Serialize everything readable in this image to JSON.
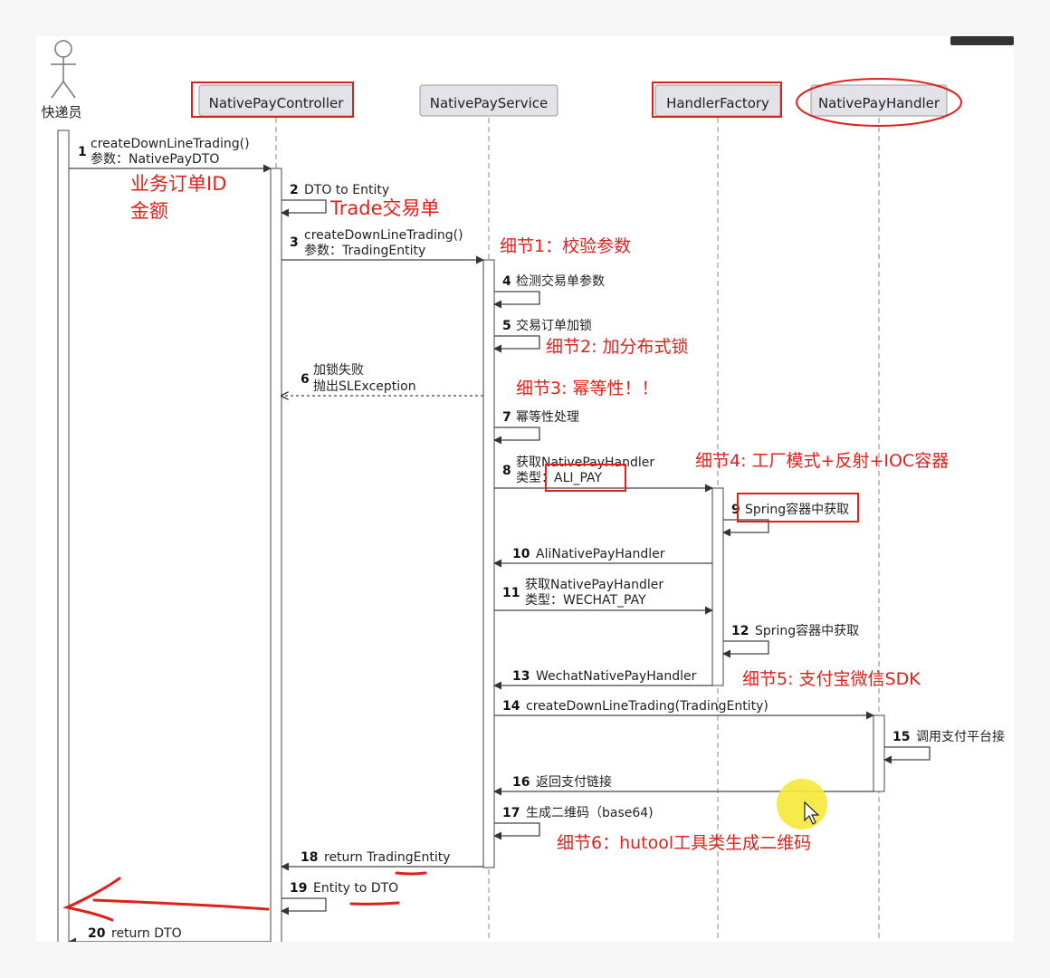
{
  "actor": {
    "label": "快递员"
  },
  "participants": [
    {
      "id": "ctrl",
      "label": "NativePayController",
      "highlight": "box"
    },
    {
      "id": "svc",
      "label": "NativePayService",
      "highlight": "none"
    },
    {
      "id": "fac",
      "label": "HandlerFactory",
      "highlight": "box"
    },
    {
      "id": "hdl",
      "label": "NativePayHandler",
      "highlight": "ellipse"
    }
  ],
  "messages": [
    {
      "n": "1",
      "lines": [
        "createDownLineTrading()",
        "参数：NativePayDTO"
      ],
      "from": "actor",
      "to": "ctrl",
      "kind": "sync"
    },
    {
      "n": "2",
      "lines": [
        "DTO to Entity"
      ],
      "from": "ctrl",
      "to": "ctrl",
      "kind": "self"
    },
    {
      "n": "3",
      "lines": [
        "createDownLineTrading()",
        "参数：TradingEntity"
      ],
      "from": "ctrl",
      "to": "svc",
      "kind": "sync"
    },
    {
      "n": "4",
      "lines": [
        "检测交易单参数"
      ],
      "from": "svc",
      "to": "svc",
      "kind": "self"
    },
    {
      "n": "5",
      "lines": [
        "交易订单加锁"
      ],
      "from": "svc",
      "to": "svc",
      "kind": "self"
    },
    {
      "n": "6",
      "lines": [
        "加锁失败",
        "抛出SLException"
      ],
      "from": "svc",
      "to": "ctrl",
      "kind": "return"
    },
    {
      "n": "7",
      "lines": [
        "幂等性处理"
      ],
      "from": "svc",
      "to": "svc",
      "kind": "self"
    },
    {
      "n": "8",
      "lines": [
        "获取NativePayHandler",
        "类型：ALI_PAY"
      ],
      "from": "svc",
      "to": "fac",
      "kind": "sync"
    },
    {
      "n": "9",
      "lines": [
        "Spring容器中获取"
      ],
      "from": "fac",
      "to": "fac",
      "kind": "self"
    },
    {
      "n": "10",
      "lines": [
        "AliNativePayHandler"
      ],
      "from": "fac",
      "to": "svc",
      "kind": "sync"
    },
    {
      "n": "11",
      "lines": [
        "获取NativePayHandler",
        "类型：WECHAT_PAY"
      ],
      "from": "svc",
      "to": "fac",
      "kind": "sync"
    },
    {
      "n": "12",
      "lines": [
        "Spring容器中获取"
      ],
      "from": "fac",
      "to": "fac",
      "kind": "self"
    },
    {
      "n": "13",
      "lines": [
        "WechatNativePayHandler"
      ],
      "from": "fac",
      "to": "svc",
      "kind": "sync"
    },
    {
      "n": "14",
      "lines": [
        "createDownLineTrading(TradingEntity)"
      ],
      "from": "svc",
      "to": "hdl",
      "kind": "sync"
    },
    {
      "n": "15",
      "lines": [
        "调用支付平台接"
      ],
      "from": "hdl",
      "to": "hdl",
      "kind": "self"
    },
    {
      "n": "16",
      "lines": [
        "返回支付链接"
      ],
      "from": "hdl",
      "to": "svc",
      "kind": "sync"
    },
    {
      "n": "17",
      "lines": [
        "生成二维码（base64)"
      ],
      "from": "svc",
      "to": "svc",
      "kind": "self"
    },
    {
      "n": "18",
      "lines": [
        "return TradingEntity"
      ],
      "from": "svc",
      "to": "ctrl",
      "kind": "sync"
    },
    {
      "n": "19",
      "lines": [
        "Entity to DTO"
      ],
      "from": "ctrl",
      "to": "ctrl",
      "kind": "self"
    },
    {
      "n": "20",
      "lines": [
        "return DTO"
      ],
      "from": "ctrl",
      "to": "actor",
      "kind": "sync"
    }
  ],
  "annotations": [
    {
      "id": "ann-order",
      "lines": [
        "业务订单ID",
        "金额"
      ]
    },
    {
      "id": "ann-trade",
      "lines": [
        "Trade交易单"
      ]
    },
    {
      "id": "ann-d1",
      "lines": [
        "细节1：校验参数"
      ]
    },
    {
      "id": "ann-d2",
      "lines": [
        "细节2: 加分布式锁"
      ]
    },
    {
      "id": "ann-d3",
      "lines": [
        "细节3: 幂等性！！"
      ]
    },
    {
      "id": "ann-d4",
      "lines": [
        "细节4: 工厂模式+反射+IOC容器"
      ]
    },
    {
      "id": "ann-d5",
      "lines": [
        "细节5: 支付宝微信SDK"
      ]
    },
    {
      "id": "ann-d6",
      "lines": [
        "细节6：hutool工具类生成二维码"
      ]
    }
  ],
  "colors": {
    "annotation": "#e0201b",
    "participant_fill": "#e2e2e8",
    "line": "#444444",
    "cursor": "#f5e83a"
  }
}
